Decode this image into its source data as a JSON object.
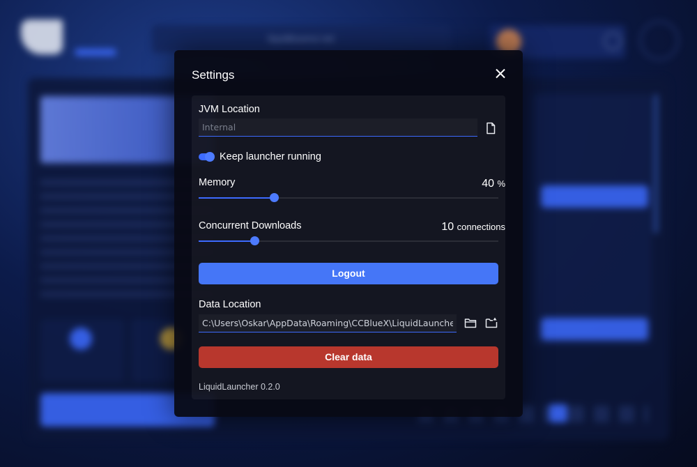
{
  "background": {
    "url_text": "liquidbounce.net"
  },
  "modal": {
    "title": "Settings",
    "jvm": {
      "label": "JVM Location",
      "placeholder": "Internal"
    },
    "keep_running": {
      "label": "Keep launcher running",
      "enabled": true
    },
    "memory": {
      "label": "Memory",
      "value": "40",
      "unit": "%",
      "fraction": 0.25
    },
    "downloads": {
      "label": "Concurrent Downloads",
      "value": "10",
      "unit": "connections",
      "fraction": 0.185
    },
    "logout_label": "Logout",
    "data_location": {
      "label": "Data Location",
      "value": "C:\\Users\\Oskar\\AppData\\Roaming\\CCBlueX\\LiquidLauncher"
    },
    "clear_label": "Clear data",
    "version": "LiquidLauncher 0.2.0"
  },
  "colors": {
    "accent": "#4576f7",
    "danger": "#b8372d"
  },
  "icons": [
    "file-icon",
    "folder-icon",
    "folder-open-icon",
    "close-icon"
  ]
}
